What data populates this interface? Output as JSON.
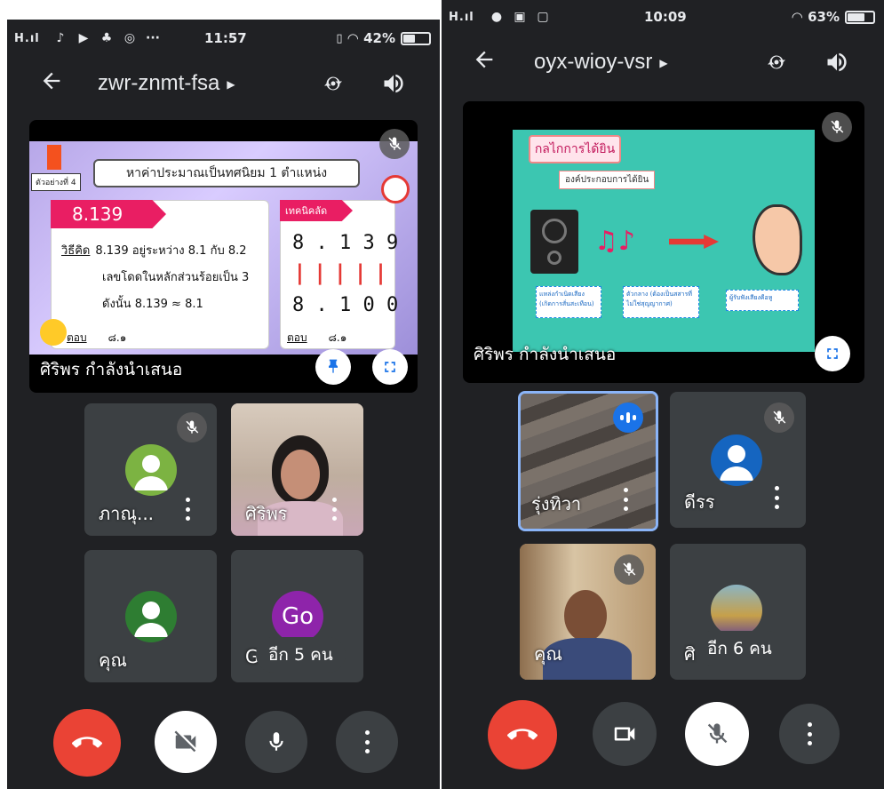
{
  "phone_a": {
    "status": {
      "signal": "H.ıl",
      "time": "11:57",
      "battery": "42%",
      "battery_level": 0.42
    },
    "meeting_code": "zwr-znmt-fsa",
    "presenter_label": "ศิริพร กำลังนำเสนอ",
    "slide": {
      "example_tag": "ตัวอย่างที่ 4",
      "heading": "หาค่าประมาณเป็นทศนิยม 1 ตำแหน่ง",
      "number": "8.139",
      "method_label": "วิธีคิด",
      "line1": "8.139 อยู่ระหว่าง 8.1 กับ 8.2",
      "line2": "เลขโดดในหลักส่วนร้อยเป็น 3",
      "line3": "ดังนั้น 8.139 ≈ 8.1",
      "answer_label": "ตอบ",
      "answer": "๘.๑",
      "tip_label": "เทคนิคลัด",
      "tip_top": "8 . 1 3 9",
      "tip_bottom": "8 . 1 0 0",
      "answer_label_2": "ตอบ",
      "answer_2": "๘.๑"
    },
    "tiles": [
      {
        "name": "ภาณุ...",
        "avatar_color": "#7cb342"
      },
      {
        "name": "ศิริพร"
      },
      {
        "name": "คุณ",
        "avatar_color": "#2e7d32"
      },
      {
        "name": "G",
        "avatar_text": "Go",
        "avatar_color": "#8e24aa",
        "more": "อีก 5 คน"
      }
    ]
  },
  "phone_b": {
    "status": {
      "signal": "H.ıl",
      "time": "10:09",
      "battery": "63%",
      "battery_level": 0.63
    },
    "meeting_code": "oyx-wioy-vsr",
    "presenter_label": "ศิริพร กำลังนำเสนอ",
    "slide": {
      "heading": "กลไกการได้ยิน",
      "sub": "องค์ประกอบการได้ยิน",
      "step1": "แหล่งกำเนิดเสียง (เกิดการสั่นสะเทือน)",
      "step2": "ตัวกลาง (ต้องเป็นสสารที่ไม่ใช่สุญญากาศ)",
      "step3": "ผู้รับฟังเสียงคือหู"
    },
    "tiles": [
      {
        "name": "รุ่งทิวา"
      },
      {
        "name": "ดีรร",
        "avatar_color": "#1565c0"
      },
      {
        "name": "คุณ"
      },
      {
        "name": "ศิ",
        "more": "อีก 6 คน"
      }
    ]
  }
}
